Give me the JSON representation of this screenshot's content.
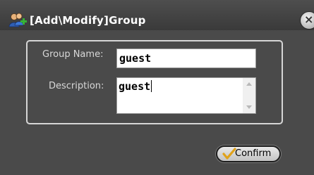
{
  "window": {
    "title": "[Add\\Modify]Group",
    "icon": "users-add-icon",
    "close_icon": "close-icon"
  },
  "form": {
    "group_name_label": "Group Name:",
    "group_name_value": "guest",
    "description_label": "Description:",
    "description_value": "guest"
  },
  "buttons": {
    "confirm_label": "Confirm",
    "confirm_icon": "checkmark-icon"
  },
  "colors": {
    "background": "#4a4a4a",
    "label_text": "#d8d8d8",
    "checkmark": "#e0a21a"
  }
}
